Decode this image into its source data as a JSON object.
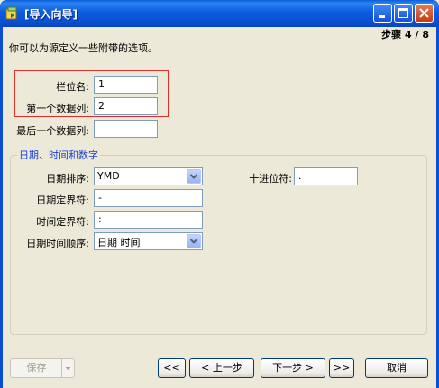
{
  "window": {
    "title": "[导入向导]",
    "step": "步骤 4 / 8"
  },
  "description": "你可以为源定义一些附带的选项。",
  "fields": {
    "field_name": {
      "label": "栏位名:",
      "value": "1"
    },
    "first_data_row": {
      "label": "第一个数据列:",
      "value": "2"
    },
    "last_data_row": {
      "label": "最后一个数据列:",
      "value": ""
    }
  },
  "group": {
    "legend": "日期、时间和数字",
    "date_order": {
      "label": "日期排序:",
      "value": "YMD"
    },
    "date_delimiter": {
      "label": "日期定界符:",
      "value": "-"
    },
    "time_delimiter": {
      "label": "时间定界符:",
      "value": ":"
    },
    "datetime_order": {
      "label": "日期时间顺序:",
      "value": "日期 时间"
    },
    "decimal_symbol": {
      "label": "十进位符:",
      "value": "."
    }
  },
  "buttons": {
    "save": "保存",
    "first": "<<",
    "prev": "< 上一步",
    "next": "下一步 >",
    "last": ">>",
    "cancel": "取消"
  }
}
